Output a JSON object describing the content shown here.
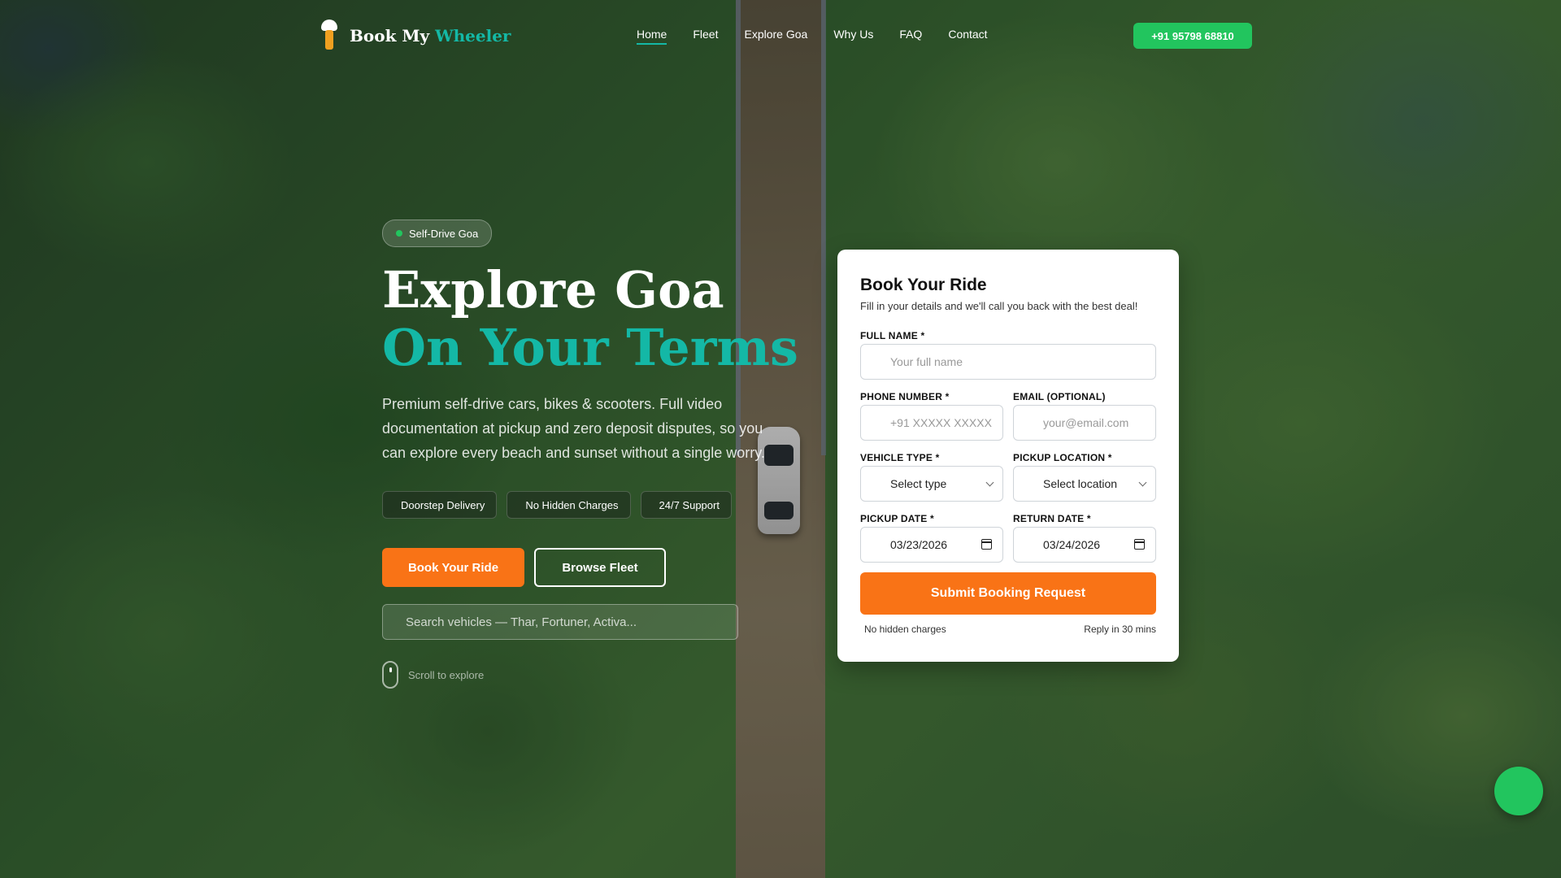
{
  "nav": {
    "brand_part1": "Book My",
    "brand_part2": "Wheeler",
    "links": [
      {
        "label": "Home"
      },
      {
        "label": "Fleet"
      },
      {
        "label": "Explore Goa"
      },
      {
        "label": "Why Us"
      },
      {
        "label": "FAQ"
      },
      {
        "label": "Contact"
      }
    ],
    "active_link": "Home",
    "phone_button": "+91 95798 68810"
  },
  "hero": {
    "badge": "Self-Drive Goa",
    "title_line1": "Explore Goa",
    "title_line2": "On Your Terms",
    "description": "Premium self-drive cars, bikes & scooters. Full video documentation at pickup and zero deposit disputes, so you can explore every beach and sunset without a single worry.",
    "chips": [
      "Doorstep Delivery",
      "No Hidden Charges",
      "24/7 Support"
    ],
    "primary_cta": "Book Your Ride",
    "secondary_cta": "Browse Fleet",
    "search_placeholder": "Search vehicles — Thar, Fortuner, Activa...",
    "scroll_hint": "Scroll to explore"
  },
  "booking": {
    "title": "Book Your Ride",
    "subtitle": "Fill in your details and we'll call you back with the best deal!",
    "full_name_label": "FULL NAME *",
    "full_name_placeholder": "Your full name",
    "phone_label": "PHONE NUMBER *",
    "phone_placeholder": "+91 XXXXX XXXXX",
    "email_label": "EMAIL (OPTIONAL)",
    "email_placeholder": "your@email.com",
    "vehicle_label": "VEHICLE TYPE *",
    "vehicle_value": "Select type",
    "location_label": "PICKUP LOCATION *",
    "location_value": "Select location",
    "pickup_date_label": "PICKUP DATE *",
    "pickup_date_value": "03/23/2026",
    "return_date_label": "RETURN DATE *",
    "return_date_value": "03/24/2026",
    "submit_label": "Submit Booking Request",
    "footer_left": "No hidden charges",
    "footer_right": "Reply in 30 mins"
  },
  "colors": {
    "accent_teal": "#14b8a6",
    "primary_orange": "#f97316",
    "whatsapp_green": "#22c55e"
  },
  "icons": [
    "logo-icon",
    "chevron-down-icon",
    "calendar-icon",
    "mouse-scroll-icon",
    "whatsapp-chat-icon"
  ]
}
